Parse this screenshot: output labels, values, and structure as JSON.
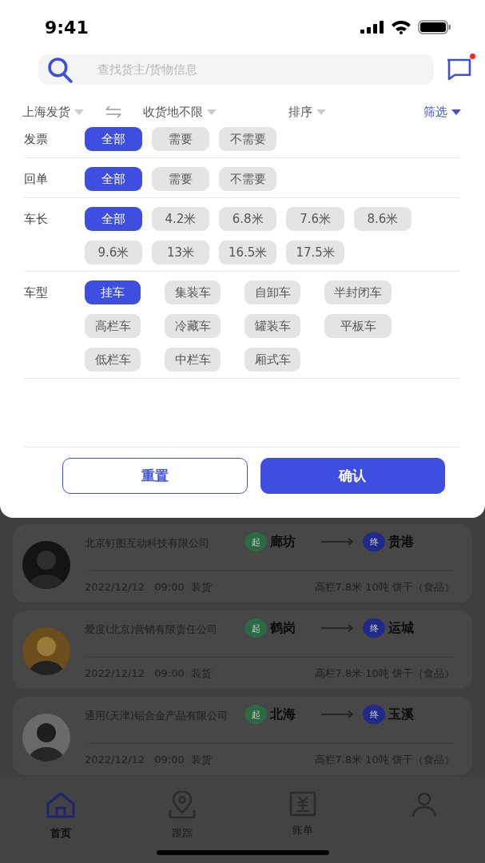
{
  "status_bar": {
    "time": "9:41"
  },
  "search": {
    "placeholder": "查找货主/货物信息",
    "has_unread": true
  },
  "filter_bar": [
    {
      "label": "上海发货",
      "kind": "dropdown",
      "selected": false
    },
    {
      "kind": "swap"
    },
    {
      "label": "收货地不限",
      "kind": "dropdown",
      "selected": false
    },
    {
      "label": "排序",
      "kind": "dropdown",
      "selected": false
    },
    {
      "label": "筛选",
      "kind": "dropdown",
      "selected": true
    }
  ],
  "filter_groups": [
    {
      "label": "发票",
      "options": [
        {
          "label": "全部",
          "selected": true
        },
        {
          "label": "需要",
          "selected": false
        },
        {
          "label": "不需要",
          "selected": false
        }
      ]
    },
    {
      "label": "回单",
      "options": [
        {
          "label": "全部",
          "selected": true
        },
        {
          "label": "需要",
          "selected": false
        },
        {
          "label": "不需要",
          "selected": false
        }
      ]
    },
    {
      "label": "车长",
      "options": [
        {
          "label": "全部",
          "selected": true
        },
        {
          "label": "4.2米",
          "selected": false
        },
        {
          "label": "6.8米",
          "selected": false
        },
        {
          "label": "7.6米",
          "selected": false
        },
        {
          "label": "8.6米",
          "selected": false
        },
        {
          "label": "9.6米",
          "selected": false
        },
        {
          "label": "13米",
          "selected": false
        },
        {
          "label": "16.5米",
          "selected": false
        },
        {
          "label": "17.5米",
          "selected": false
        }
      ]
    },
    {
      "label": "车型",
      "options": [
        {
          "label": "挂车",
          "selected": true
        },
        {
          "label": "集装车",
          "selected": false
        },
        {
          "label": "自卸车",
          "selected": false
        },
        {
          "label": "半封闭车",
          "selected": false
        },
        {
          "label": "高栏车",
          "selected": false
        },
        {
          "label": "冷藏车",
          "selected": false
        },
        {
          "label": "罐装车",
          "selected": false
        },
        {
          "label": "平板车",
          "selected": false
        },
        {
          "label": "低栏车",
          "selected": false
        },
        {
          "label": "中栏车",
          "selected": false
        },
        {
          "label": "厢式车",
          "selected": false
        }
      ]
    }
  ],
  "actions": [
    {
      "label": "重置",
      "kind": "secondary"
    },
    {
      "label": "确认",
      "kind": "primary"
    }
  ],
  "orders": [
    {
      "company": "北京钉图互动科技有限公司",
      "origin_badge": "起",
      "origin": "廊坊",
      "destination_badge": "终",
      "destination": "贵港",
      "time": "2022/12/12   09:00  装货",
      "cargo": "高栏7.8米 10吨 饼干（食品）"
    },
    {
      "company": "爱度(北京)营销有限责任公司",
      "origin_badge": "起",
      "origin": "鹤岗",
      "destination_badge": "终",
      "destination": "运城",
      "time": "2022/12/12   09:00  装货",
      "cargo": "高栏7.8米 10吨 饼干（食品）"
    },
    {
      "company": "通用(天津)铝合金产品有限公司",
      "origin_badge": "起",
      "origin": "北海",
      "destination_badge": "终",
      "destination": "玉溪",
      "time": "2022/12/12   09:00  装货",
      "cargo": "高栏7.8米 10吨 饼干（食品）"
    }
  ],
  "tab_bar": [
    {
      "label": "首页",
      "selected": true
    },
    {
      "label": "跟踪",
      "selected": false
    },
    {
      "label": "账单",
      "selected": false
    },
    {
      "selected": false
    }
  ]
}
